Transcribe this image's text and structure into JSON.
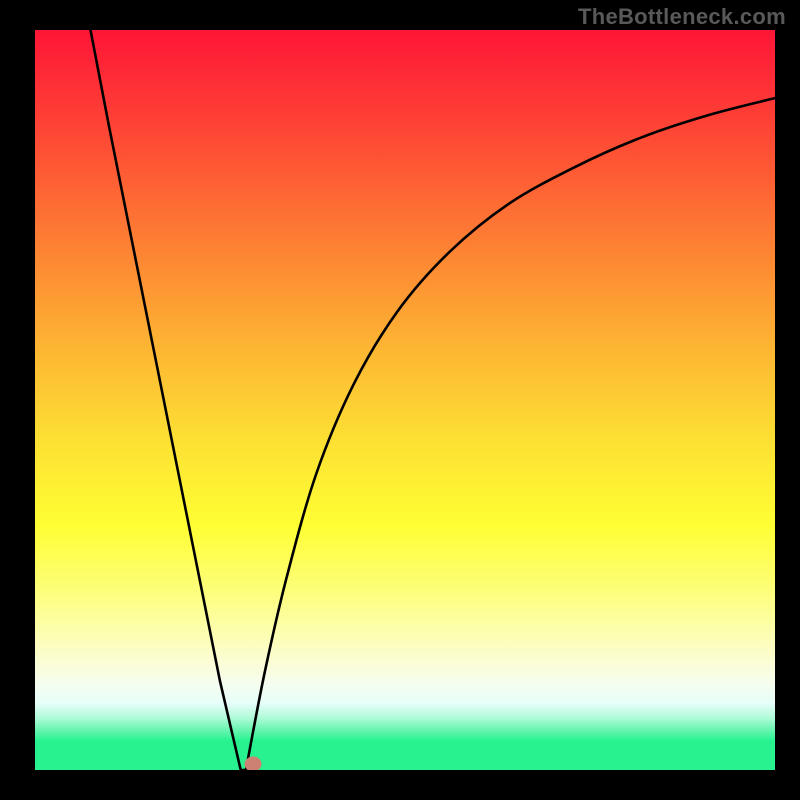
{
  "watermark": "TheBottleneck.com",
  "chart_data": {
    "type": "line",
    "title": "",
    "xlabel": "",
    "ylabel": "",
    "xlim": [
      0,
      100
    ],
    "ylim": [
      0,
      100
    ],
    "grid": false,
    "series": [
      {
        "name": "left-branch",
        "x": [
          7.5,
          10,
          13,
          16,
          19,
          22,
          25,
          27.8
        ],
        "values": [
          100,
          87,
          72,
          57,
          42,
          27,
          12,
          0
        ]
      },
      {
        "name": "right-branch",
        "x": [
          28.5,
          31,
          34,
          38,
          43,
          49,
          56,
          64,
          73,
          82,
          91,
          100
        ],
        "values": [
          0,
          13,
          26,
          40,
          52,
          62,
          70,
          76.5,
          81.5,
          85.5,
          88.5,
          90.8
        ]
      }
    ],
    "marker": {
      "x": 29.5,
      "y": 0.8,
      "color": "#cd8173"
    },
    "background_gradient": {
      "orientation": "vertical",
      "stops": [
        {
          "pos": 0.0,
          "color": "#fe1537"
        },
        {
          "pos": 0.15,
          "color": "#fe4335"
        },
        {
          "pos": 0.35,
          "color": "#fd8433"
        },
        {
          "pos": 0.5,
          "color": "#fdb533"
        },
        {
          "pos": 0.65,
          "color": "#fde133"
        },
        {
          "pos": 0.78,
          "color": "#fefe33"
        },
        {
          "pos": 0.86,
          "color": "#fbfdd8"
        },
        {
          "pos": 0.93,
          "color": "#aefbd8"
        },
        {
          "pos": 0.96,
          "color": "#6af5b0"
        },
        {
          "pos": 1.0,
          "color": "#28f28f"
        }
      ]
    }
  }
}
